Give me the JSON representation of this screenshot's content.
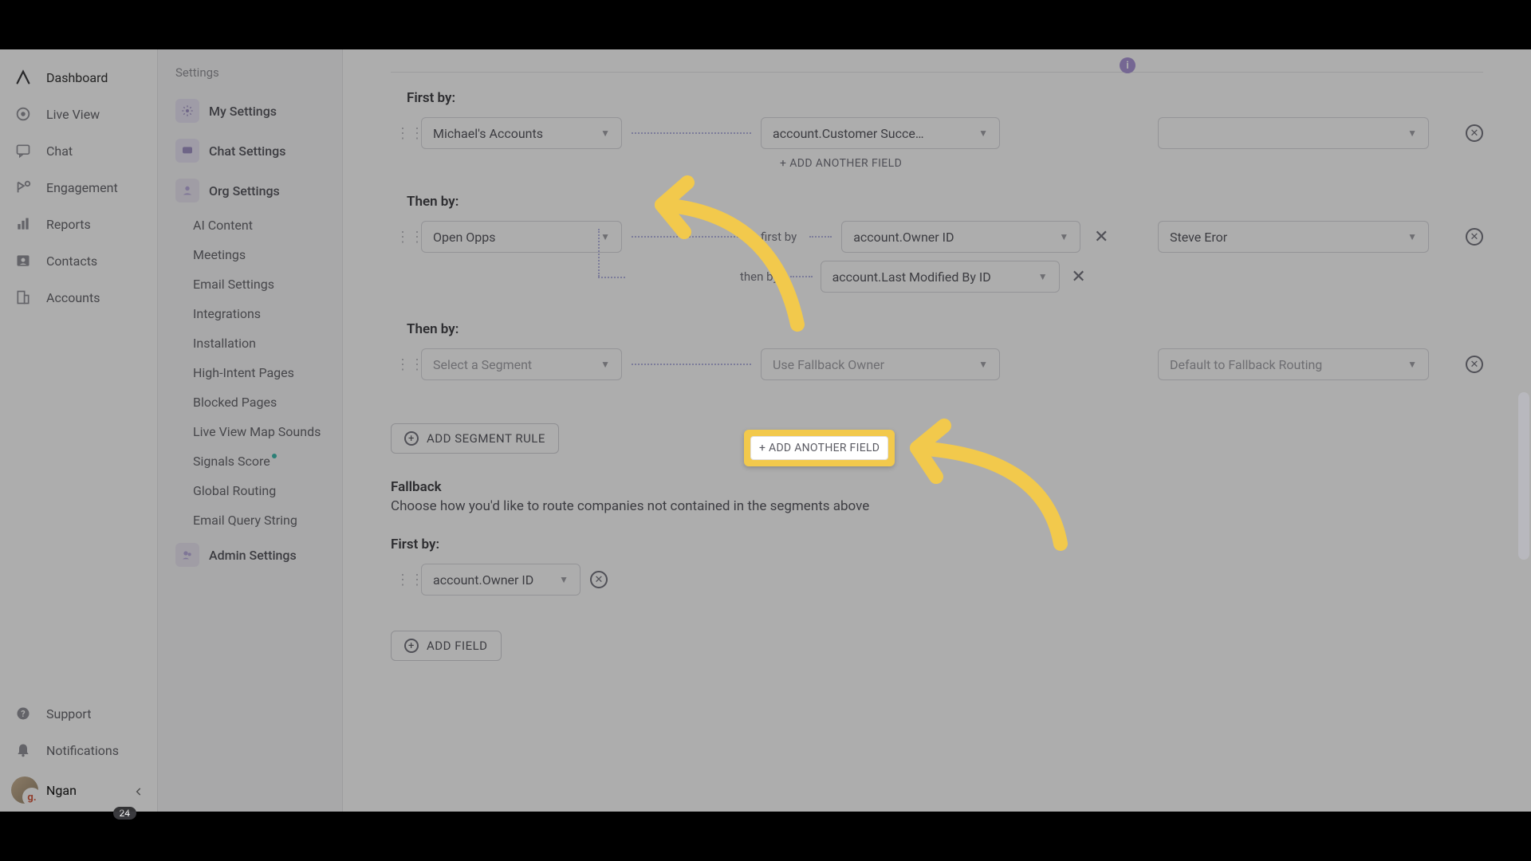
{
  "nav": {
    "items": [
      {
        "label": "Dashboard",
        "icon": "logo"
      },
      {
        "label": "Live View",
        "icon": "eye"
      },
      {
        "label": "Chat",
        "icon": "chat"
      },
      {
        "label": "Engagement",
        "icon": "engage"
      },
      {
        "label": "Reports",
        "icon": "bars"
      },
      {
        "label": "Contacts",
        "icon": "contact"
      },
      {
        "label": "Accounts",
        "icon": "building"
      }
    ],
    "support": "Support",
    "notifications": "Notifications",
    "user_name": "Ngan",
    "g_badge": "g.",
    "count": "24"
  },
  "settings": {
    "title": "Settings",
    "my_settings": "My Settings",
    "chat_settings": "Chat Settings",
    "org_settings": "Org Settings",
    "subs": [
      "AI Content",
      "Meetings",
      "Email Settings",
      "Integrations",
      "Installation",
      "High-Intent Pages",
      "Blocked Pages",
      "Live View Map Sounds",
      "Signals Score",
      "Global Routing",
      "Email Query String"
    ],
    "admin_settings": "Admin Settings"
  },
  "main": {
    "first_by": "First by:",
    "then_by": "Then by:",
    "rule1": {
      "segment": "Michael's Accounts",
      "field": "account.Customer Succe…",
      "owner": ""
    },
    "add_another_field": "+ ADD ANOTHER FIELD",
    "rule2": {
      "segment": "Open Opps",
      "first_by_label": "first by",
      "then_by_label": "then by",
      "field1": "account.Owner ID",
      "field2": "account.Last Modified By ID",
      "owner": "Steve Eror"
    },
    "rule3": {
      "segment_placeholder": "Select a Segment",
      "field_placeholder": "Use Fallback Owner",
      "owner_placeholder": "Default to Fallback Routing"
    },
    "add_segment_rule": "ADD SEGMENT RULE",
    "fallback_title": "Fallback",
    "fallback_desc": "Choose how you'd like to route companies not contained in the segments above",
    "fallback_field": "account.Owner ID",
    "add_field": "ADD FIELD"
  },
  "highlight": {
    "label": "+ ADD ANOTHER FIELD"
  },
  "info_icon": "i",
  "colors": {
    "accent": "#f2c94c",
    "purple": "#a58fd6"
  }
}
